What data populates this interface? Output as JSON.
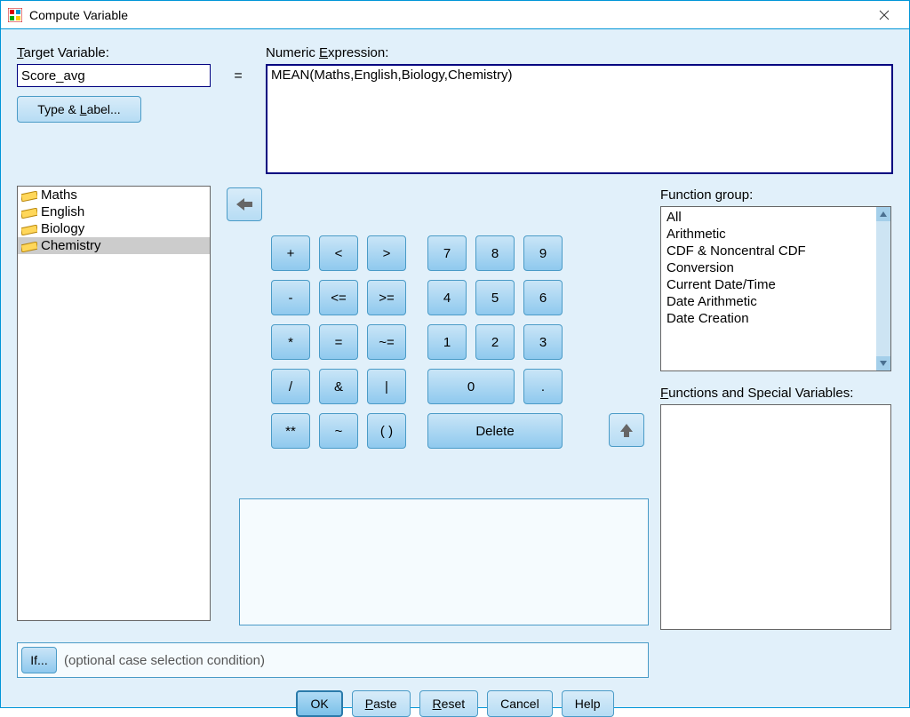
{
  "window": {
    "title": "Compute Variable"
  },
  "labels": {
    "target": "Target Variable:",
    "expression": "Numeric Expression:",
    "type_label": "Type & Label...",
    "function_group": "Function group:",
    "functions_special": "Functions and Special Variables:",
    "if": "If...",
    "if_hint": "(optional case selection condition)"
  },
  "values": {
    "target": "Score_avg",
    "expression": "MEAN(Maths,English,Biology,Chemistry)",
    "equals": "="
  },
  "variables": [
    {
      "name": "Maths",
      "selected": false
    },
    {
      "name": "English",
      "selected": false
    },
    {
      "name": "Biology",
      "selected": false
    },
    {
      "name": "Chemistry",
      "selected": true
    }
  ],
  "keypad": {
    "r1": [
      "+",
      "<",
      ">",
      "7",
      "8",
      "9"
    ],
    "r2": [
      "-",
      "<=",
      ">=",
      "4",
      "5",
      "6"
    ],
    "r3": [
      "*",
      "=",
      "~=",
      "1",
      "2",
      "3"
    ],
    "r4": [
      "/",
      "&",
      "|",
      "0",
      "."
    ],
    "r5": [
      "**",
      "~",
      "( )",
      "Delete"
    ]
  },
  "function_groups": [
    "All",
    "Arithmetic",
    "CDF & Noncentral CDF",
    "Conversion",
    "Current Date/Time",
    "Date Arithmetic",
    "Date Creation"
  ],
  "buttons": {
    "ok": "OK",
    "paste": "Paste",
    "reset": "Reset",
    "cancel": "Cancel",
    "help": "Help"
  }
}
